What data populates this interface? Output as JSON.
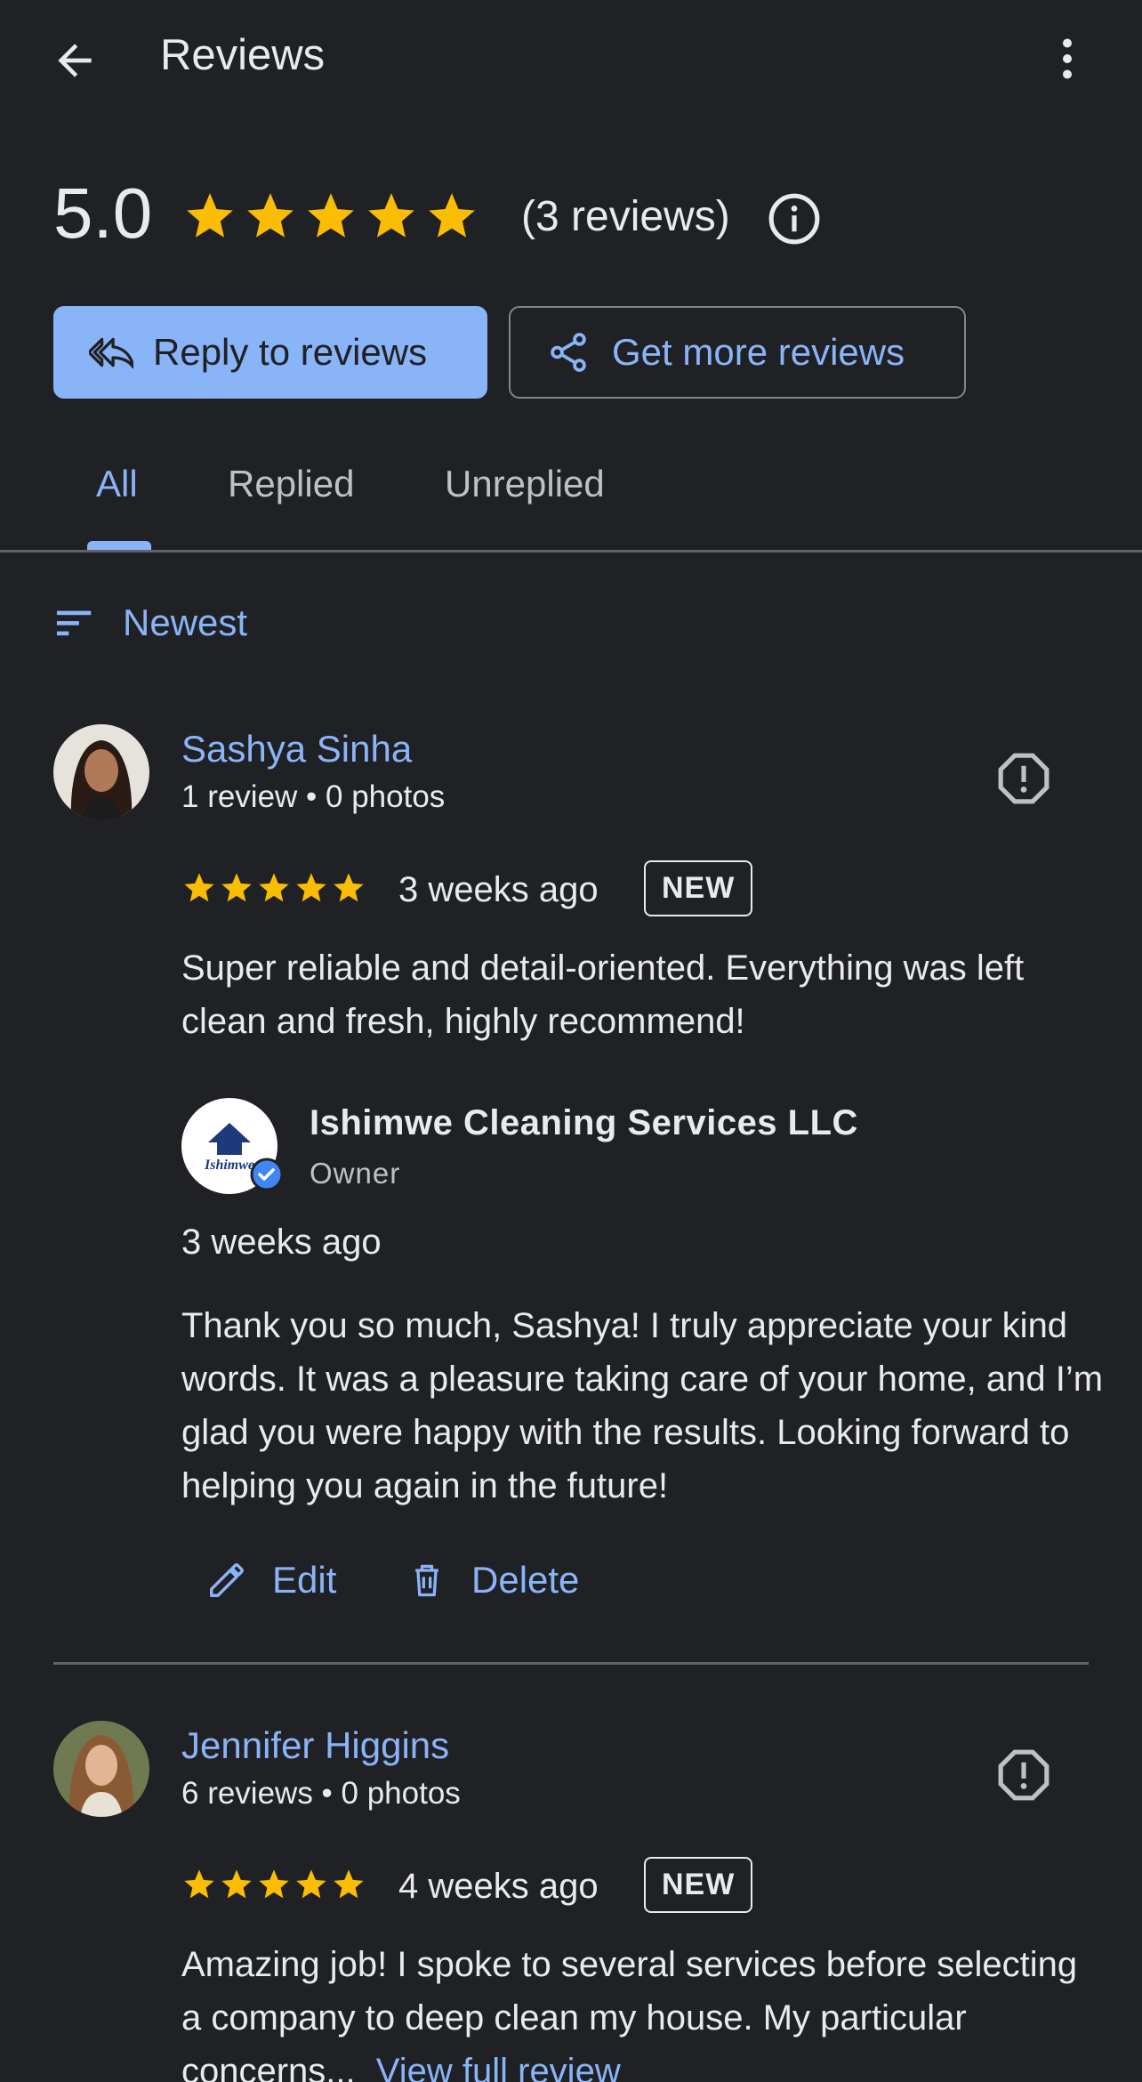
{
  "header": {
    "title": "Reviews"
  },
  "summary": {
    "rating": "5.0",
    "stars": 5,
    "count_text": "(3 reviews)"
  },
  "actions": {
    "reply_label": "Reply to reviews",
    "more_label": "Get more reviews"
  },
  "tabs": [
    {
      "label": "All",
      "selected": true
    },
    {
      "label": "Replied",
      "selected": false
    },
    {
      "label": "Unreplied",
      "selected": false
    }
  ],
  "sort": {
    "label": "Newest"
  },
  "reviews": [
    {
      "name": "Sashya Sinha",
      "meta": "1 review • 0 photos",
      "stars": 5,
      "time": "3 weeks ago",
      "badge": "NEW",
      "text": "Super reliable and detail-oriented. Everything was left clean and fresh, highly recommend!",
      "reply": {
        "business": "Ishimwe Cleaning Services LLC",
        "role": "Owner",
        "time": "3 weeks ago",
        "text": "Thank you so much, Sashya! I truly appreciate your kind words. It was a pleasure taking care of your home, and I’m glad you were happy with the results. Looking forward to helping you again in the future!",
        "logo_text": "Ishimwe",
        "edit_label": "Edit",
        "delete_label": "Delete"
      }
    },
    {
      "name": "Jennifer Higgins",
      "meta": "6 reviews • 0 photos",
      "stars": 5,
      "time": "4 weeks ago",
      "badge": "NEW",
      "text_start": "Amazing job! I spoke to several services before selecting a company to deep clean my house. My particular concerns...",
      "link": "View full review"
    }
  ],
  "colors": {
    "accent": "#8ab4f8",
    "star": "#fbbc04",
    "background": "#202124"
  }
}
